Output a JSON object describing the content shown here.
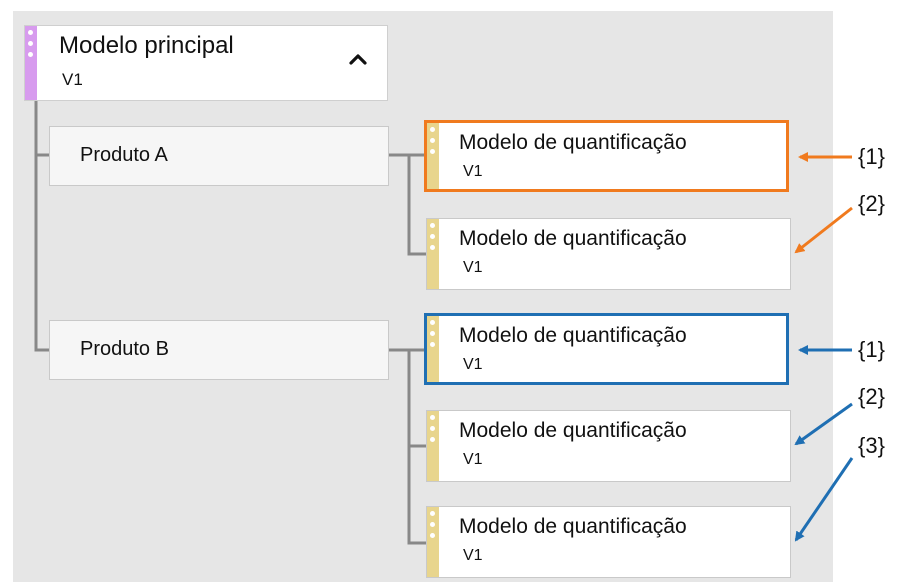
{
  "colors": {
    "orange_accent": "#f07a1e",
    "blue_accent": "#1f6fb3",
    "main_strip": "#d79bee",
    "model_strip": "#e8d58d",
    "connector": "#888888",
    "background": "#e6e6e6"
  },
  "main_model": {
    "title": "Modelo principal",
    "version": "V1",
    "toggle_icon": "chevron-up-icon"
  },
  "products": [
    {
      "label": "Produto A",
      "models": [
        {
          "title": "Modelo de quantificação",
          "version": "V1",
          "highlight": "orange",
          "callout": "{1}"
        },
        {
          "title": "Modelo de quantificação",
          "version": "V1",
          "highlight": "none",
          "callout": "{2}"
        }
      ]
    },
    {
      "label": "Produto B",
      "models": [
        {
          "title": "Modelo de quantificação",
          "version": "V1",
          "highlight": "blue",
          "callout": "{1}"
        },
        {
          "title": "Modelo de quantificação",
          "version": "V1",
          "highlight": "none",
          "callout": "{2}"
        },
        {
          "title": "Modelo de quantificação",
          "version": "V1",
          "highlight": "none",
          "callout": "{3}"
        }
      ]
    }
  ]
}
